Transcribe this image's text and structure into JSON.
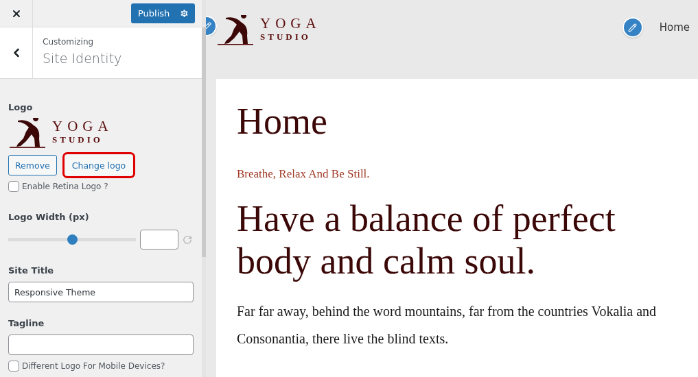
{
  "topbar": {
    "publish_label": "Publish"
  },
  "section": {
    "breadcrumb": "Customizing",
    "title": "Site Identity"
  },
  "logo_control": {
    "label": "Logo",
    "logo": {
      "line1": "YOGA",
      "line2": "STUDIO"
    },
    "buttons": [
      {
        "label": "Remove",
        "highlighted": false
      },
      {
        "label": "Change logo",
        "highlighted": true
      }
    ]
  },
  "retina_checkbox": {
    "label": "Enable Retina Logo ?",
    "checked": false
  },
  "logo_width": {
    "label": "Logo Width (px)",
    "level": 0.5
  },
  "site_title": {
    "label": "Site Title",
    "value": "Responsive Theme"
  },
  "tagline": {
    "label": "Tagline"
  },
  "mobile_checkbox": {
    "label": "Different Logo For Mobile Devices?",
    "checked": false
  },
  "preview": {
    "logo": {
      "line1": "YOGA",
      "line2": "STUDIO"
    },
    "nav": [
      {
        "label": "Home"
      }
    ],
    "page_title": "Home",
    "subtitle": "Breathe, Relax And Be Still.",
    "heading": "Have a balance of perfect body and calm soul.",
    "paragraph": "Far far away, behind the word mountains, far from the countries Vokalia and Consonantia, there live the blind texts."
  }
}
